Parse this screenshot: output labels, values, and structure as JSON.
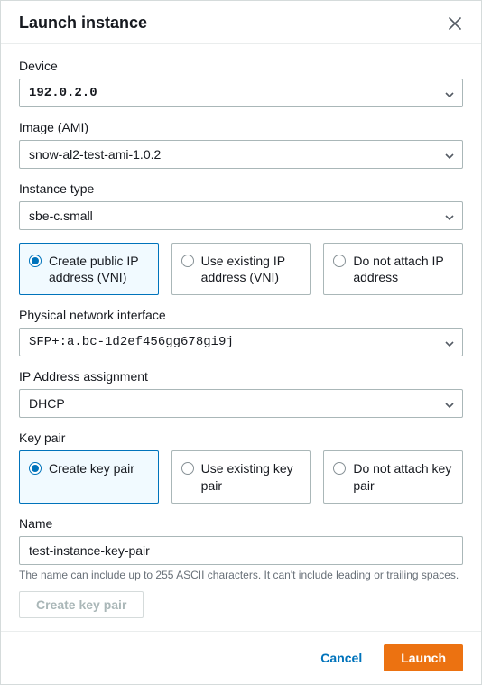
{
  "header": {
    "title": "Launch instance"
  },
  "device": {
    "label": "Device",
    "value": "192.0.2.0"
  },
  "image": {
    "label": "Image (AMI)",
    "value": "snow-al2-test-ami-1.0.2"
  },
  "instanceType": {
    "label": "Instance type",
    "value": "sbe-c.small"
  },
  "ipMode": {
    "options": [
      "Create public IP address (VNI)",
      "Use existing IP address (VNI)",
      "Do not attach IP address"
    ],
    "selectedIndex": 0
  },
  "pni": {
    "label": "Physical network interface",
    "value": "SFP+:a.bc-1d2ef456gg678gi9j"
  },
  "ipAssign": {
    "label": "IP Address assignment",
    "value": "DHCP"
  },
  "keyPair": {
    "label": "Key pair",
    "options": [
      "Create key pair",
      "Use existing key pair",
      "Do not attach key pair"
    ],
    "selectedIndex": 0
  },
  "name": {
    "label": "Name",
    "value": "test-instance-key-pair",
    "helper": "The name can include up to 255 ASCII characters. It can't include leading or trailing spaces."
  },
  "buttons": {
    "createKeyPair": "Create key pair",
    "cancel": "Cancel",
    "launch": "Launch"
  }
}
